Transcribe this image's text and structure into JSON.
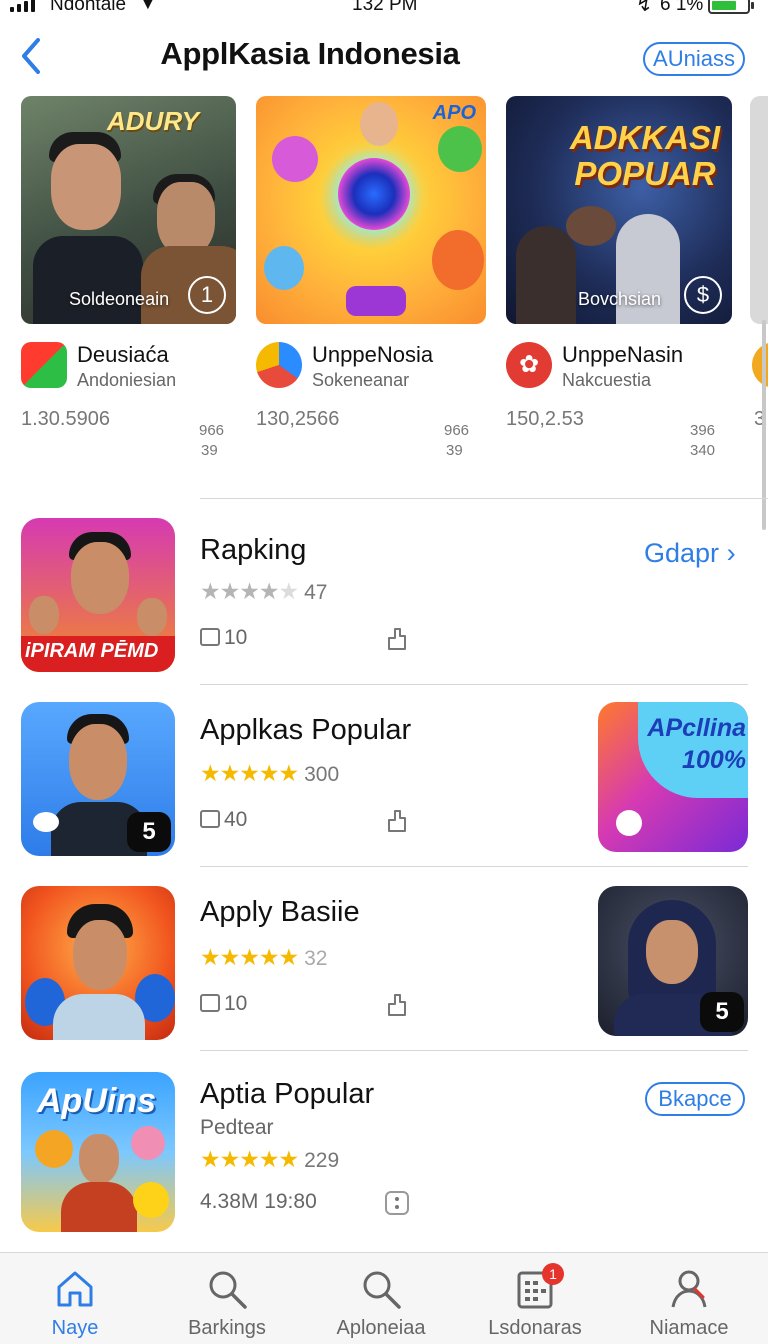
{
  "status": {
    "carrier": "Ndontale",
    "time": "132 PM",
    "battery": "6 1%"
  },
  "header": {
    "title": "ApplKasia Indonesia",
    "button": "AUniass"
  },
  "featured": [
    {
      "art_brand": "ADURY",
      "caption": "Soldeoneain",
      "badge": "1",
      "name": "Deusiaća",
      "subtitle": "Andoniesian",
      "number": "1.30.5906",
      "stat_a": "966",
      "stat_b": "39",
      "icon_color": "#e6372b"
    },
    {
      "art_brand": "APO",
      "caption": "",
      "badge": "",
      "name": "UnppeNosia",
      "subtitle": "Sokeneanar",
      "number": "130,2566",
      "stat_a": "966",
      "stat_b": "39",
      "icon_color": "#f0a12a"
    },
    {
      "art_brand": "ADKKASI POPUAR",
      "caption": "Bovchsian",
      "badge": "$",
      "name": "UnppeNasin",
      "subtitle": "Nakcuestia",
      "number": "150,2.53",
      "stat_a": "396",
      "stat_b": "340",
      "icon_color": "#d93b34"
    },
    {
      "art_brand": "",
      "caption": "",
      "badge": "",
      "name": "",
      "subtitle": "",
      "number": "3",
      "stat_a": "",
      "stat_b": "",
      "icon_color": "#f2a91f"
    }
  ],
  "list": [
    {
      "name": "Rapking",
      "stars": 4,
      "count": "47",
      "meta": "10",
      "action": "Gdapr",
      "art_label": "iPIRAM PĒMD"
    },
    {
      "name": "Applkas Popular",
      "stars": 5,
      "count": "300",
      "meta": "40",
      "badge": "5",
      "side_label": "APcllina 100%"
    },
    {
      "name": "Apply Basiie",
      "stars": 5,
      "count": "32",
      "meta": "10",
      "side_badge": "5"
    },
    {
      "name": "Aptia Popular",
      "subtitle": "Pedtear",
      "stars": 5,
      "count": "229",
      "meta": "4.38M 19:80",
      "action": "Bkapce",
      "art_label": "ApUins"
    }
  ],
  "tabs": [
    {
      "label": "Naye",
      "icon": "home-icon",
      "active": true
    },
    {
      "label": "Barkings",
      "icon": "search-icon"
    },
    {
      "label": "Aploneiaa",
      "icon": "search-icon"
    },
    {
      "label": "Lsdonaras",
      "icon": "calendar-icon",
      "badge": "1"
    },
    {
      "label": "Niamace",
      "icon": "person-icon"
    }
  ],
  "colors": {
    "accent": "#2f7ee6",
    "star": "#f5b900",
    "badge": "#e4342c"
  }
}
